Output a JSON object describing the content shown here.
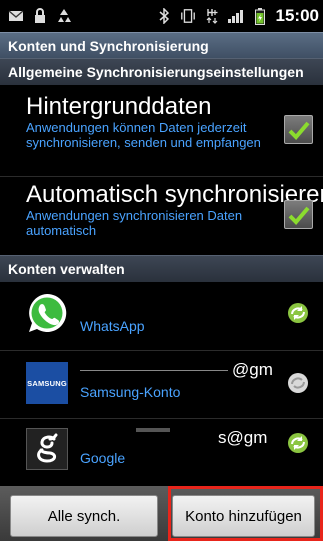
{
  "status_bar": {
    "time": "15:00",
    "icons": [
      "message-icon",
      "lock-icon",
      "recycle-icon",
      "bluetooth-icon",
      "vibrate-icon",
      "data-hplus-icon",
      "signal-icon",
      "battery-icon"
    ]
  },
  "screen_title": "Konten und Synchronisierung",
  "general_section": {
    "header": "Allgemeine Synchronisierungseinstellungen",
    "settings": [
      {
        "title": "Hintergrunddaten",
        "description": "Anwendungen können Daten jederzeit synchronisieren, senden und empfangen",
        "checked": true
      },
      {
        "title": "Automatisch synchronisieren",
        "description": "Anwendungen synchronisieren Daten automatisch",
        "checked": true
      }
    ]
  },
  "accounts_section": {
    "header": "Konten verwalten",
    "accounts": [
      {
        "name": "WhatsApp",
        "email": "",
        "sync_active": true
      },
      {
        "name": "Samsung-Konto",
        "email": "@gm",
        "sync_active": false
      },
      {
        "name": "Google",
        "email": "s@gm",
        "sync_active": true
      }
    ],
    "samsung_logo_text": "SAMSUNG"
  },
  "buttons": {
    "sync_all": "Alle synch.",
    "add_account": "Konto hinzufügen"
  },
  "colors": {
    "accent_blue": "#4aa3ff",
    "highlight_red": "#e8251b",
    "sync_green": "#8bc541"
  }
}
